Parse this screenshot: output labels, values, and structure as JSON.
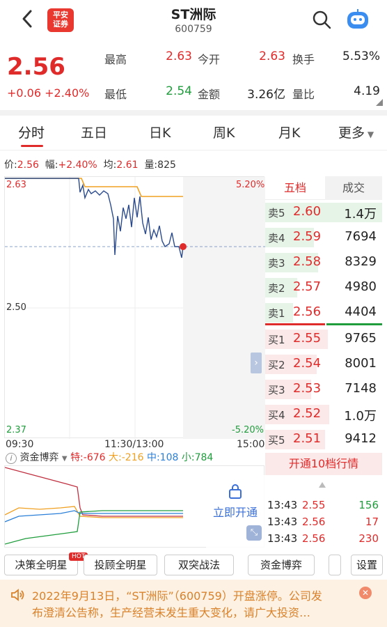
{
  "header": {
    "back_icon": "chevron-left-icon",
    "logo_text_line1": "平安",
    "logo_text_line2": "证券",
    "stock_name": "ST洲际",
    "stock_code": "600759",
    "search_icon": "search-icon",
    "assistant_icon": "robot-icon"
  },
  "quote": {
    "price": "2.56",
    "change": "+0.06 +2.40%",
    "high_label": "最高",
    "high": "2.63",
    "open_label": "今开",
    "open": "2.63",
    "turnover_label": "换手",
    "turnover": "5.53%",
    "low_label": "最低",
    "low": "2.54",
    "amount_label": "金额",
    "amount": "3.26亿",
    "vol_ratio_label": "量比",
    "vol_ratio": "4.19"
  },
  "tabs": [
    "分时",
    "五日",
    "日K",
    "周K",
    "月K",
    "更多"
  ],
  "info_strip": {
    "price_label": "价:",
    "price": "2.56",
    "pct_label": "幅:",
    "pct": "+2.40%",
    "avg_label": "均:",
    "avg": "2.61",
    "vol_label": "量:",
    "vol": "825"
  },
  "chart": {
    "y_top": "2.63",
    "y_mid": "2.50",
    "y_bottom": "2.37",
    "pct_top": "5.20%",
    "pct_bottom": "-5.20%",
    "t_start": "09:30",
    "t_mid": "11:30/13:00",
    "t_end": "15:00",
    "arrow": "›"
  },
  "order_book": {
    "tab1": "五档",
    "tab2": "成交",
    "sells": [
      {
        "label": "卖5",
        "price": "2.60",
        "vol": "1.4万"
      },
      {
        "label": "卖4",
        "price": "2.59",
        "vol": "7694"
      },
      {
        "label": "卖3",
        "price": "2.58",
        "vol": "8329"
      },
      {
        "label": "卖2",
        "price": "2.57",
        "vol": "4980"
      },
      {
        "label": "卖1",
        "price": "2.56",
        "vol": "4404"
      }
    ],
    "buys": [
      {
        "label": "买1",
        "price": "2.55",
        "vol": "9765"
      },
      {
        "label": "买2",
        "price": "2.54",
        "vol": "8001"
      },
      {
        "label": "买3",
        "price": "2.53",
        "vol": "7148"
      },
      {
        "label": "买4",
        "price": "2.52",
        "vol": "1.0万"
      },
      {
        "label": "买5",
        "price": "2.51",
        "vol": "9412"
      }
    ],
    "open10": "开通10档行情"
  },
  "ticks": [
    {
      "time": "13:43",
      "price": "2.55",
      "vol": "156",
      "color": "#1f9d3c"
    },
    {
      "time": "13:43",
      "price": "2.56",
      "vol": "17",
      "color": "#e02b2b"
    },
    {
      "time": "13:43",
      "price": "2.56",
      "vol": "230",
      "color": "#e02b2b"
    }
  ],
  "capital_flow": {
    "title": "资金博弈",
    "special": "特:-676",
    "large": "大:-216",
    "medium": "中:108",
    "small": "小:784",
    "unlock": "立即开通"
  },
  "buttons": [
    "决策全明星",
    "投顾全明星",
    "双突战法",
    "资金博弈",
    "设置"
  ],
  "hot_badge": "HOT",
  "notice": {
    "line1": "2022年9月13日，“ST洲际”（600759）开盘涨停。公司发",
    "line2": "布澄清公告称，生产经营未发生重大变化，请广大投资…"
  },
  "colors": {
    "up": "#e02b2b",
    "down": "#1f9d3c",
    "price_line": "#2a4a8c",
    "avg_line": "#f0a020"
  }
}
